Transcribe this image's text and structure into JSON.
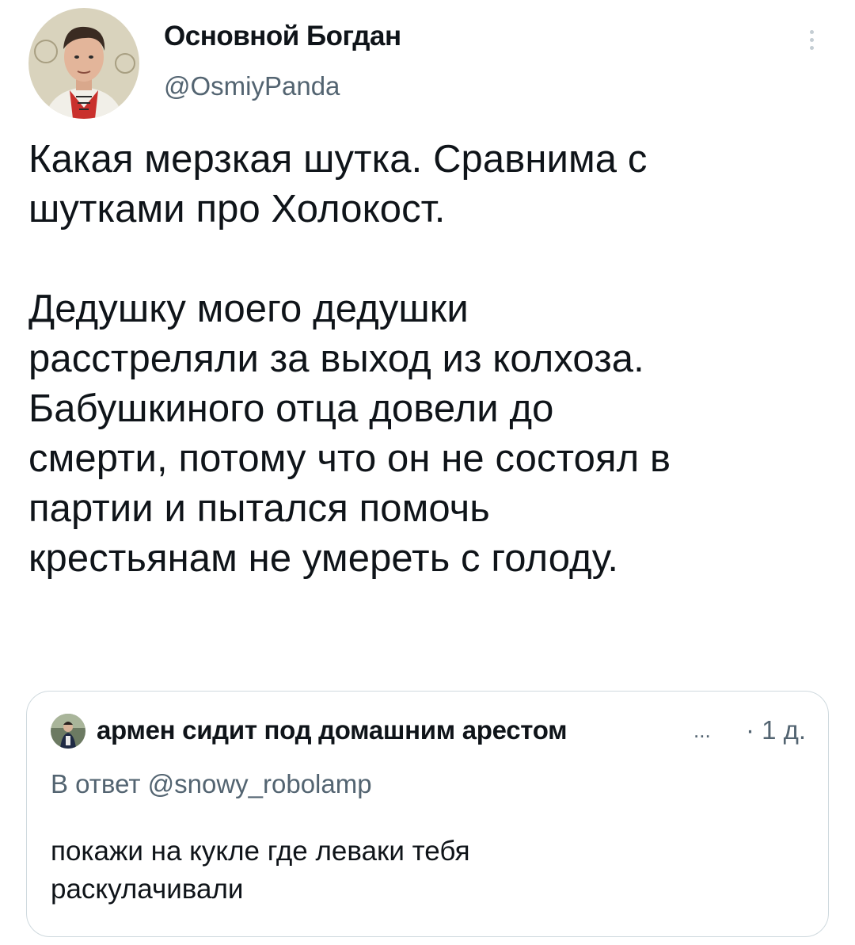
{
  "tweet": {
    "author_name": "Основной Богдан",
    "author_handle": "@OsmiyPanda",
    "text": "Какая мерзкая шутка. Сравнима с\nшутками про Холокост.\n\nДедушку моего дедушки\nрасстреляли за выход из колхоза.\nБабушкиного отца довели до\nсмерти, потому что он не состоял в\nпартии и пытался помочь\nкрестьянам не умереть с голоду."
  },
  "quoted_tweet": {
    "author_name": "армен сидит под домашним арестом",
    "truncation": "...",
    "time": "· 1 д.",
    "reply_context": "В ответ @snowy_robolamp",
    "text": "покажи на кукле где леваки тебя\nраскулачивали"
  },
  "icons": {
    "more": "more-vertical-icon"
  },
  "colors": {
    "text": "#0f1419",
    "secondary_text": "#536471",
    "card_border": "#cfd9de"
  }
}
